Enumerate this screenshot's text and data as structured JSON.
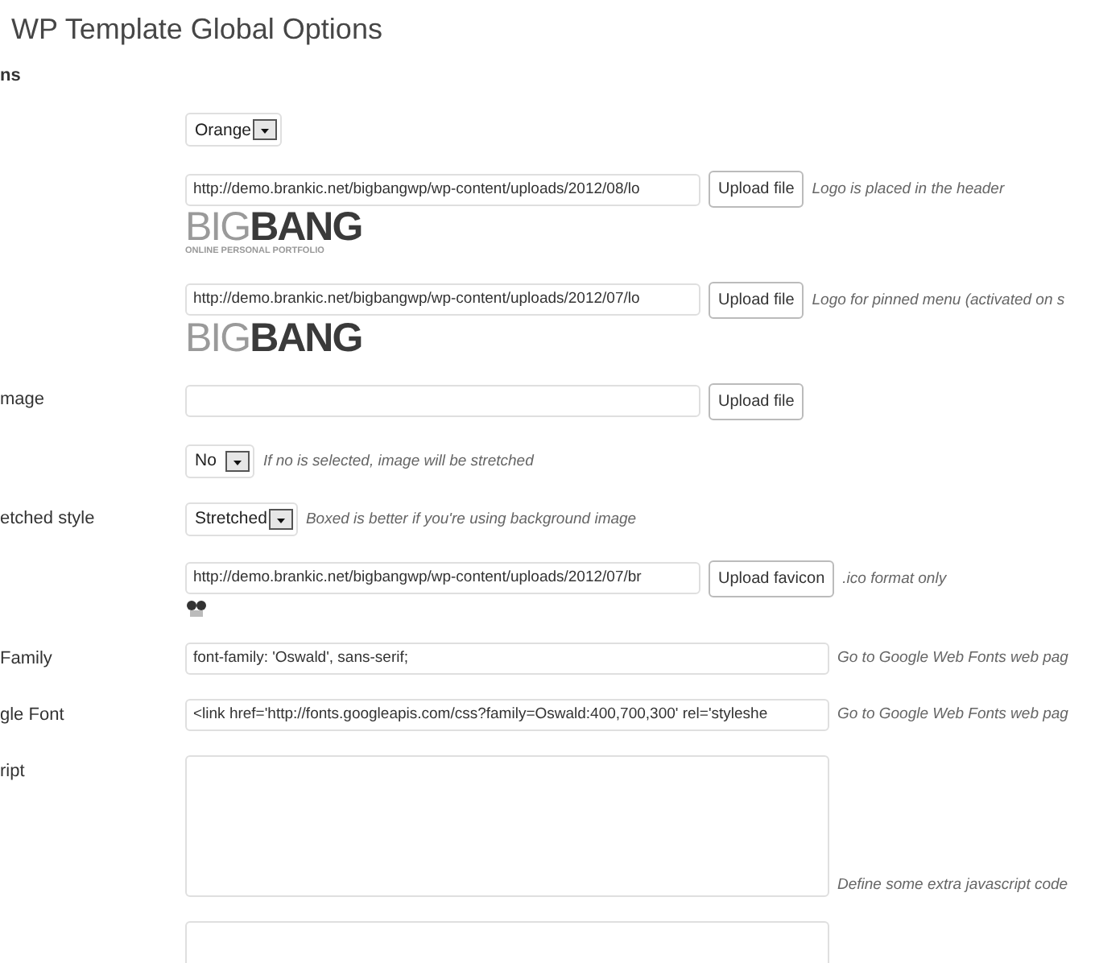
{
  "page": {
    "title": "WP Template Global Options",
    "section": "ns"
  },
  "rows": [
    {
      "kind": "select",
      "label": "",
      "value": "Orange"
    },
    {
      "kind": "upload",
      "label": "",
      "value": "http://demo.brankic.net/bigbangwp/wp-content/uploads/2012/08/lo",
      "button": "Upload file",
      "hint": "Logo is placed in the header",
      "preview": {
        "kind": "logo",
        "light": "BIG",
        "bold": "BANG",
        "tagline": "ONLINE PERSONAL PORTFOLIO"
      }
    },
    {
      "kind": "upload",
      "label": "",
      "value": "http://demo.brankic.net/bigbangwp/wp-content/uploads/2012/07/lo",
      "button": "Upload file",
      "hint": "Logo for pinned menu (activated on s",
      "preview": {
        "kind": "logo",
        "light": "BIG",
        "bold": "BANG"
      }
    },
    {
      "kind": "upload",
      "label": "mage",
      "button": "Upload file"
    },
    {
      "kind": "select",
      "label": "",
      "value": "No",
      "hint": "If no is selected, image will be stretched"
    },
    {
      "kind": "select",
      "label": "etched style",
      "value": "Stretched",
      "hint": "Boxed is better if you're using background image"
    },
    {
      "kind": "upload",
      "label": "",
      "value": "http://demo.brankic.net/bigbangwp/wp-content/uploads/2012/07/br",
      "button": "Upload favicon",
      "hint": ".ico format only",
      "preview": {
        "kind": "favicon"
      }
    },
    {
      "kind": "text",
      "label": "Family",
      "value": "font-family: 'Oswald', sans-serif;",
      "hint": "Go to Google Web Fonts web pag"
    },
    {
      "kind": "text",
      "label": "gle Font",
      "value": "<link href='http://fonts.googleapis.com/css?family=Oswald:400,700,300' rel='styleshe",
      "hint": "Go to Google Web Fonts web pag"
    },
    {
      "kind": "textarea",
      "label": "ript",
      "hint": "Define some extra javascript code"
    },
    {
      "kind": "textarea",
      "label": ""
    }
  ]
}
